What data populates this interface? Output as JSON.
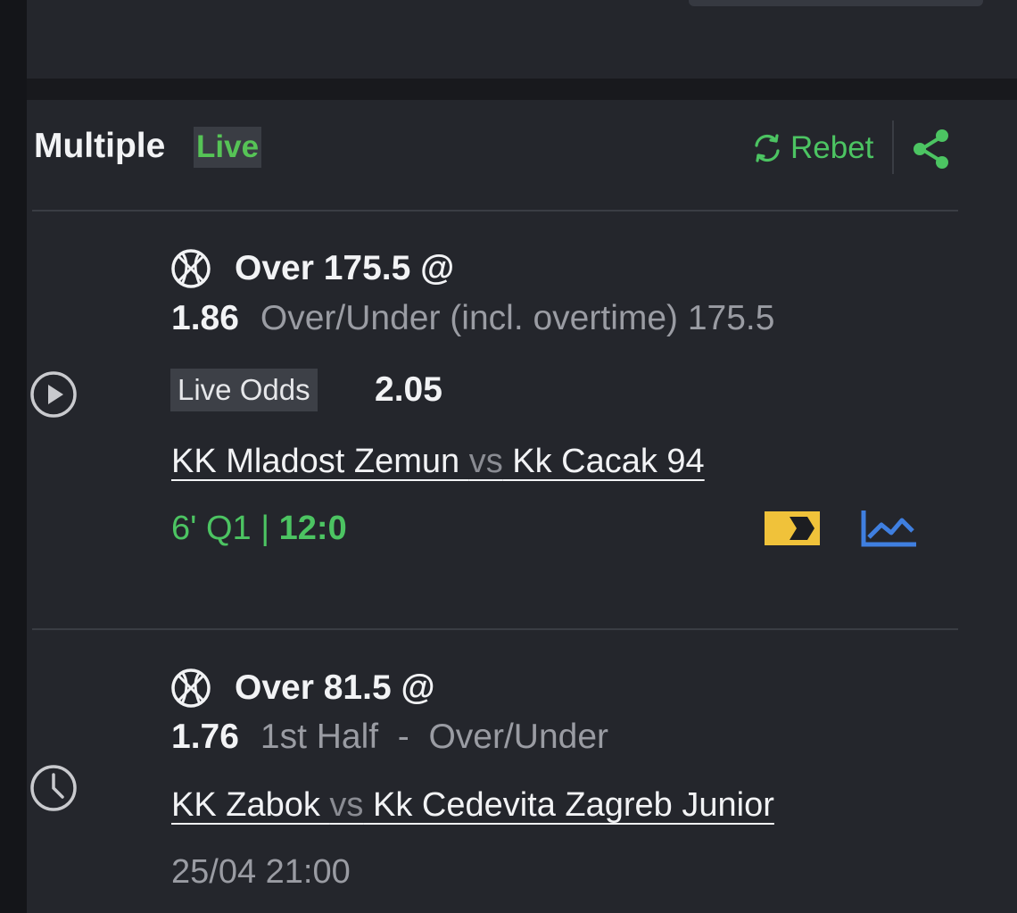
{
  "header": {
    "title": "Multiple",
    "live_tag": "Live",
    "rebet_label": "Rebet",
    "colors": {
      "accent_green": "#4cc462",
      "background": "#24262c"
    }
  },
  "icons": {
    "rebet": "refresh-icon",
    "share": "share-icon",
    "live_status": "play-circle-icon",
    "scheduled_status": "clock-icon",
    "sport": "basketball-icon",
    "stream": "live-stream-icon",
    "stats": "stats-chart-icon"
  },
  "selections": [
    {
      "pick": "Over 175.5 @",
      "odds": "1.86",
      "market": "Over/Under (incl. overtime) 175.5",
      "live_odds_label": "Live Odds",
      "live_odds": "2.05",
      "home": "KK Mladost Zemun ",
      "vs": "vs",
      "away": " Kk Cacak 94",
      "time": "6' Q1",
      "separator": " | ",
      "score": "12:0"
    },
    {
      "pick": "Over 81.5 @",
      "odds": "1.76",
      "market": "1st Half  -  Over/Under",
      "home": "KK Zabok ",
      "vs": "vs",
      "away": " Kk Cedevita Zagreb Junior",
      "datetime": "25/04 21:00"
    }
  ]
}
